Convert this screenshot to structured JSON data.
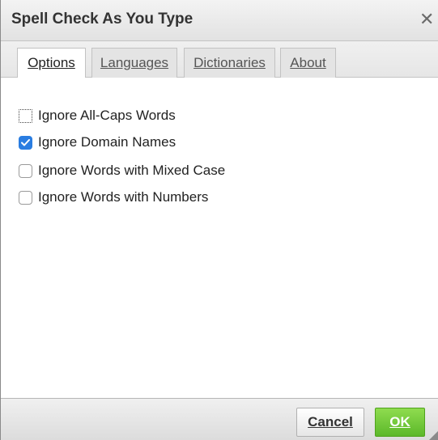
{
  "dialog": {
    "title": "Spell Check As You Type",
    "close_glyph": "✕"
  },
  "tabs": [
    {
      "label": "Options",
      "active": true
    },
    {
      "label": "Languages",
      "active": false
    },
    {
      "label": "Dictionaries",
      "active": false
    },
    {
      "label": "About",
      "active": false
    }
  ],
  "options": [
    {
      "label": "Ignore All-Caps Words",
      "checked": false,
      "focused": true
    },
    {
      "label": "Ignore Domain Names",
      "checked": true,
      "focused": false
    },
    {
      "label": "Ignore Words with Mixed Case",
      "checked": false,
      "focused": false
    },
    {
      "label": "Ignore Words with Numbers",
      "checked": false,
      "focused": false
    }
  ],
  "footer": {
    "cancel_label": "Cancel",
    "ok_label": "OK"
  },
  "colors": {
    "checkbox_checked": "#2a7de1",
    "ok_button": "#5cb82a"
  }
}
